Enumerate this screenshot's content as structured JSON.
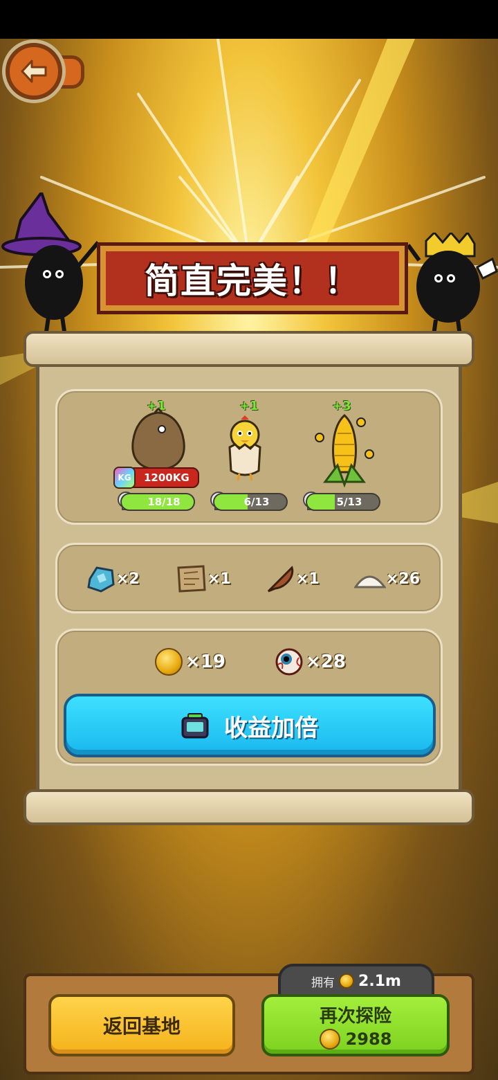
{
  "banner": {
    "title": "简直完美！！"
  },
  "animals": [
    {
      "name": "sack",
      "bonus": "+1",
      "weight": "1200KG",
      "weight_icon": "KG",
      "progress_text": "18/18",
      "progress": 1.0
    },
    {
      "name": "chick",
      "bonus": "+1",
      "progress_text": "6/13",
      "progress": 0.46
    },
    {
      "name": "corn",
      "bonus": "+3",
      "progress_text": "5/13",
      "progress": 0.38
    }
  ],
  "materials": [
    {
      "icon": "blue-gem-icon",
      "count": "×2"
    },
    {
      "icon": "map-scroll-icon",
      "count": "×1"
    },
    {
      "icon": "feather-icon",
      "count": "×1"
    },
    {
      "icon": "salt-pile-icon",
      "count": "×26"
    }
  ],
  "rewards": [
    {
      "icon": "coin-icon",
      "count": "×19"
    },
    {
      "icon": "eyeball-icon",
      "count": "×28"
    }
  ],
  "double_button": {
    "label": "收益加倍",
    "icon": "tv-icon"
  },
  "wallet": {
    "label": "拥有",
    "value": "2.1m"
  },
  "buttons": {
    "return_label": "返回基地",
    "again_label": "再次探险",
    "again_cost": "2988"
  },
  "colors": {
    "banner": "#b1301e",
    "double": "#19b8ee",
    "return": "#f4b21a",
    "again": "#7cd21f"
  }
}
